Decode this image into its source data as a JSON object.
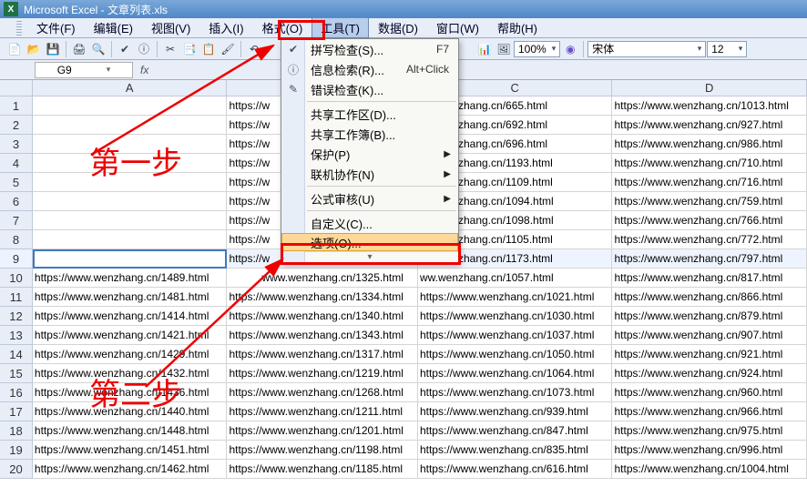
{
  "title": "Microsoft Excel - 文章列表.xls",
  "menubar": [
    "文件(F)",
    "编辑(E)",
    "视图(V)",
    "插入(I)",
    "格式(O)",
    "工具(T)",
    "数据(D)",
    "窗口(W)",
    "帮助(H)"
  ],
  "menubar_active_index": 5,
  "zoom": "100%",
  "font_name": "宋体",
  "font_size": "12",
  "name_box": "G9",
  "columns": [
    "A",
    "B",
    "C",
    "D"
  ],
  "annotations": {
    "step1": "第一步",
    "step2": "第二步"
  },
  "dropdown": {
    "groups": [
      [
        {
          "icon": "✔",
          "label": "拼写检查(S)...",
          "shortcut": "F7"
        },
        {
          "icon": "ⓘ",
          "label": "信息检索(R)...",
          "shortcut": "Alt+Click"
        },
        {
          "icon": "✎",
          "label": "错误检查(K)..."
        }
      ],
      [
        {
          "label": "共享工作区(D)..."
        },
        {
          "label": "共享工作簿(B)..."
        },
        {
          "label": "保护(P)",
          "submenu": true
        },
        {
          "label": "联机协作(N)",
          "submenu": true
        }
      ],
      [
        {
          "label": "公式审核(U)",
          "submenu": true
        }
      ],
      [
        {
          "label": "自定义(C)..."
        },
        {
          "label": "选项(O)...",
          "highlight": true
        }
      ]
    ]
  },
  "rows": [
    {
      "n": 1,
      "a": "",
      "b": "https://w",
      "c": "ww.wenzhang.cn/665.html",
      "d": "https://www.wenzhang.cn/1013.html"
    },
    {
      "n": 2,
      "a": "",
      "b": "https://w",
      "c": "ww.wenzhang.cn/692.html",
      "d": "https://www.wenzhang.cn/927.html"
    },
    {
      "n": 3,
      "a": "",
      "b": "https://w",
      "c": "ww.wenzhang.cn/696.html",
      "d": "https://www.wenzhang.cn/986.html"
    },
    {
      "n": 4,
      "a": "",
      "b": "https://w",
      "c": "ww.wenzhang.cn/1193.html",
      "d": "https://www.wenzhang.cn/710.html"
    },
    {
      "n": 5,
      "a": "",
      "b": "https://w",
      "c": "ww.wenzhang.cn/1109.html",
      "d": "https://www.wenzhang.cn/716.html"
    },
    {
      "n": 6,
      "a": "",
      "b": "https://w",
      "c": "ww.wenzhang.cn/1094.html",
      "d": "https://www.wenzhang.cn/759.html"
    },
    {
      "n": 7,
      "a": "",
      "b": "https://w",
      "c": "ww.wenzhang.cn/1098.html",
      "d": "https://www.wenzhang.cn/766.html"
    },
    {
      "n": 8,
      "a": "",
      "b": "https://w",
      "c": "ww.wenzhang.cn/1105.html",
      "d": "https://www.wenzhang.cn/772.html"
    },
    {
      "n": 9,
      "a": "",
      "b": "https://w",
      "c": "ww.wenzhang.cn/1173.html",
      "d": "https://www.wenzhang.cn/797.html",
      "sel": true
    },
    {
      "n": 10,
      "a": "https://www.wenzhang.cn/1489.html",
      "b": "www.wenzhang.cn/1325.html",
      "bp": "https://",
      "c": "ww.wenzhang.cn/1057.html",
      "d": "https://www.wenzhang.cn/817.html"
    },
    {
      "n": 11,
      "a": "https://www.wenzhang.cn/1481.html",
      "b": "https://www.wenzhang.cn/1334.html",
      "c": "https://www.wenzhang.cn/1021.html",
      "d": "https://www.wenzhang.cn/866.html"
    },
    {
      "n": 12,
      "a": "https://www.wenzhang.cn/1414.html",
      "b": "https://www.wenzhang.cn/1340.html",
      "c": "https://www.wenzhang.cn/1030.html",
      "d": "https://www.wenzhang.cn/879.html"
    },
    {
      "n": 13,
      "a": "https://www.wenzhang.cn/1421.html",
      "b": "https://www.wenzhang.cn/1343.html",
      "c": "https://www.wenzhang.cn/1037.html",
      "d": "https://www.wenzhang.cn/907.html"
    },
    {
      "n": 14,
      "a": "https://www.wenzhang.cn/1429.html",
      "b": "https://www.wenzhang.cn/1317.html",
      "c": "https://www.wenzhang.cn/1050.html",
      "d": "https://www.wenzhang.cn/921.html"
    },
    {
      "n": 15,
      "a": "https://www.wenzhang.cn/1432.html",
      "b": "https://www.wenzhang.cn/1219.html",
      "c": "https://www.wenzhang.cn/1064.html",
      "d": "https://www.wenzhang.cn/924.html"
    },
    {
      "n": 16,
      "a": "https://www.wenzhang.cn/1436.html",
      "b": "https://www.wenzhang.cn/1268.html",
      "c": "https://www.wenzhang.cn/1073.html",
      "d": "https://www.wenzhang.cn/960.html"
    },
    {
      "n": 17,
      "a": "https://www.wenzhang.cn/1440.html",
      "b": "https://www.wenzhang.cn/1211.html",
      "c": "https://www.wenzhang.cn/939.html",
      "d": "https://www.wenzhang.cn/966.html"
    },
    {
      "n": 18,
      "a": "https://www.wenzhang.cn/1448.html",
      "b": "https://www.wenzhang.cn/1201.html",
      "c": "https://www.wenzhang.cn/847.html",
      "d": "https://www.wenzhang.cn/975.html"
    },
    {
      "n": 19,
      "a": "https://www.wenzhang.cn/1451.html",
      "b": "https://www.wenzhang.cn/1198.html",
      "c": "https://www.wenzhang.cn/835.html",
      "d": "https://www.wenzhang.cn/996.html"
    },
    {
      "n": 20,
      "a": "https://www.wenzhang.cn/1462.html",
      "b": "https://www.wenzhang.cn/1185.html",
      "c": "https://www.wenzhang.cn/616.html",
      "d": "https://www.wenzhang.cn/1004.html"
    }
  ]
}
